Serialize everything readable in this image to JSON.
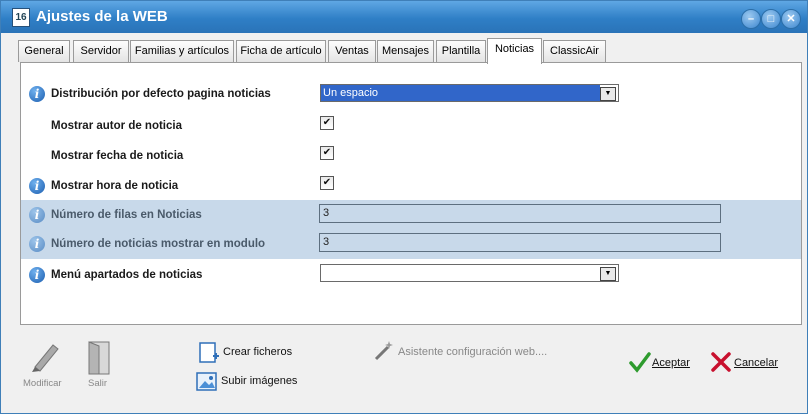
{
  "window": {
    "title": "Ajustes de la WEB",
    "icon_text": "16"
  },
  "titlebar_buttons": {
    "minimize": "–",
    "maximize": "□",
    "close": "✕"
  },
  "tabs": [
    {
      "label": "General"
    },
    {
      "label": "Servidor"
    },
    {
      "label": "Familias y artículos"
    },
    {
      "label": "Ficha de artículo"
    },
    {
      "label": "Ventas"
    },
    {
      "label": "Mensajes"
    },
    {
      "label": "Plantilla"
    },
    {
      "label": "Noticias",
      "active": true
    },
    {
      "label": "ClassicAir"
    }
  ],
  "settings": {
    "distribucion": {
      "label": "Distribución por defecto pagina noticias",
      "value": "Un espacio"
    },
    "autor": {
      "label": "Mostrar autor de noticia",
      "checked": true
    },
    "fecha": {
      "label": "Mostrar fecha de noticia",
      "checked": true
    },
    "hora": {
      "label": "Mostrar hora de noticia",
      "checked": true
    },
    "filas": {
      "label": "Número de filas en Noticias",
      "value": "3"
    },
    "num_noticias": {
      "label": "Número de noticias mostrar en modulo",
      "value": "3"
    },
    "menu": {
      "label": "Menú apartados de noticias",
      "value": ""
    }
  },
  "toolbar": {
    "modificar": "Modificar",
    "salir": "Salir",
    "crear_ficheros": "Crear ficheros",
    "subir_imagenes": "Subir imágenes",
    "asistente": "Asistente configuración web....",
    "aceptar": "Aceptar",
    "cancelar": "Cancelar"
  },
  "colors": {
    "titlebar": "#2f7fc6",
    "highlight_row": "#c8d9ea",
    "selection": "#3166c9",
    "accept": "#2e9b2e",
    "cancel": "#c8102e"
  }
}
